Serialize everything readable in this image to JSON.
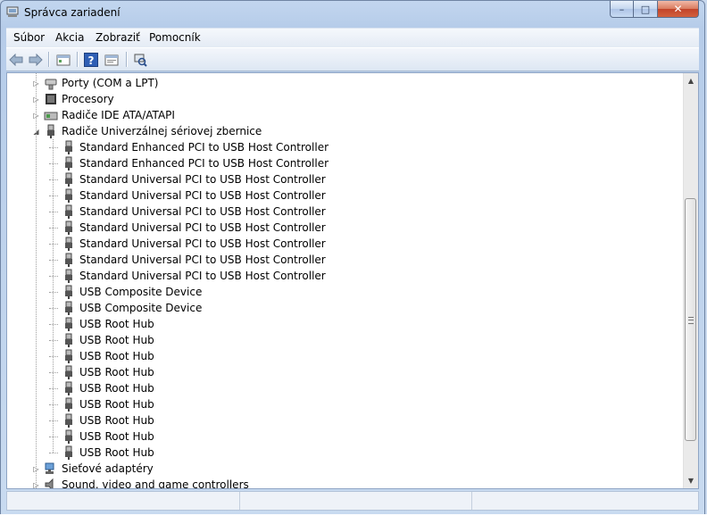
{
  "window": {
    "title": "Správca zariadení",
    "controls": {
      "minimize": "–",
      "maximize": "□",
      "close": "✕"
    }
  },
  "menu": {
    "items": [
      "Súbor",
      "Akcia",
      "Zobraziť",
      "Pomocník"
    ]
  },
  "toolbar": {
    "buttons": [
      "back-icon",
      "forward-icon",
      "device-view-icon",
      "help-icon",
      "properties-icon",
      "scan-hardware-icon"
    ]
  },
  "tree": {
    "items": [
      {
        "label": "Porty (COM a LPT)",
        "level": 1,
        "state": "collapsed",
        "icon": "port-icon"
      },
      {
        "label": "Procesory",
        "level": 1,
        "state": "collapsed",
        "icon": "processor-icon"
      },
      {
        "label": "Radiče IDE ATA/ATAPI",
        "level": 1,
        "state": "collapsed",
        "icon": "ide-controller-icon"
      },
      {
        "label": "Radiče Univerzálnej sériovej zbernice",
        "level": 1,
        "state": "expanded",
        "icon": "usb-icon"
      },
      {
        "label": "Standard Enhanced PCI to USB Host Controller",
        "level": 2,
        "icon": "usb-device-icon"
      },
      {
        "label": "Standard Enhanced PCI to USB Host Controller",
        "level": 2,
        "icon": "usb-device-icon"
      },
      {
        "label": "Standard Universal PCI to USB Host Controller",
        "level": 2,
        "icon": "usb-device-icon"
      },
      {
        "label": "Standard Universal PCI to USB Host Controller",
        "level": 2,
        "icon": "usb-device-icon"
      },
      {
        "label": "Standard Universal PCI to USB Host Controller",
        "level": 2,
        "icon": "usb-device-icon"
      },
      {
        "label": "Standard Universal PCI to USB Host Controller",
        "level": 2,
        "icon": "usb-device-icon"
      },
      {
        "label": "Standard Universal PCI to USB Host Controller",
        "level": 2,
        "icon": "usb-device-icon"
      },
      {
        "label": "Standard Universal PCI to USB Host Controller",
        "level": 2,
        "icon": "usb-device-icon"
      },
      {
        "label": "Standard Universal PCI to USB Host Controller",
        "level": 2,
        "icon": "usb-device-icon"
      },
      {
        "label": "USB Composite Device",
        "level": 2,
        "icon": "usb-device-icon"
      },
      {
        "label": "USB Composite Device",
        "level": 2,
        "icon": "usb-device-icon"
      },
      {
        "label": "USB Root Hub",
        "level": 2,
        "icon": "usb-device-icon"
      },
      {
        "label": "USB Root Hub",
        "level": 2,
        "icon": "usb-device-icon"
      },
      {
        "label": "USB Root Hub",
        "level": 2,
        "icon": "usb-device-icon"
      },
      {
        "label": "USB Root Hub",
        "level": 2,
        "icon": "usb-device-icon"
      },
      {
        "label": "USB Root Hub",
        "level": 2,
        "icon": "usb-device-icon"
      },
      {
        "label": "USB Root Hub",
        "level": 2,
        "icon": "usb-device-icon"
      },
      {
        "label": "USB Root Hub",
        "level": 2,
        "icon": "usb-device-icon"
      },
      {
        "label": "USB Root Hub",
        "level": 2,
        "icon": "usb-device-icon"
      },
      {
        "label": "USB Root Hub",
        "level": 2,
        "icon": "usb-device-icon"
      },
      {
        "label": "Sieťové adaptéry",
        "level": 1,
        "state": "collapsed",
        "icon": "network-adapter-icon"
      },
      {
        "label": "Sound, video and game controllers",
        "level": 1,
        "state": "collapsed",
        "icon": "sound-icon"
      }
    ]
  },
  "colors": {
    "frame": "#c2d6ef",
    "menubar": "#f5f8fc",
    "content_bg": "#ffffff",
    "close_button": "#c2442a"
  }
}
